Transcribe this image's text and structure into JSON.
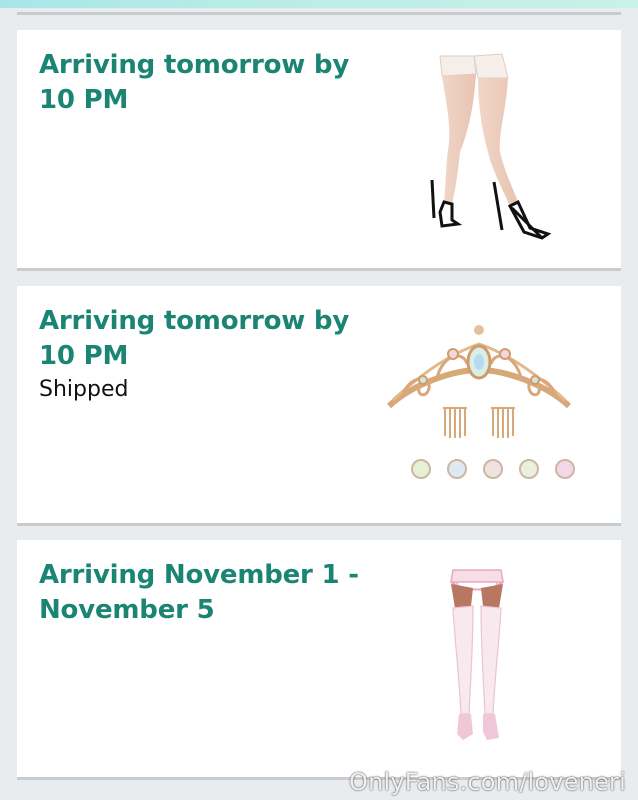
{
  "orders": [
    {
      "arrival": "Arriving tomorrow by 10 PM",
      "status": "",
      "product_icon": "thigh-high-stockings-icon"
    },
    {
      "arrival": "Arriving tomorrow by 10 PM",
      "status": "Shipped",
      "product_icon": "tiara-icon"
    },
    {
      "arrival": "Arriving November 1 - November 5",
      "status": "",
      "product_icon": "garter-stockings-icon"
    }
  ],
  "watermark": "OnlyFans.com/loveneri",
  "colors": {
    "arrival_text": "#1b8574",
    "background": "#e9ecef",
    "card": "#ffffff",
    "divider": "#c9cccf"
  }
}
